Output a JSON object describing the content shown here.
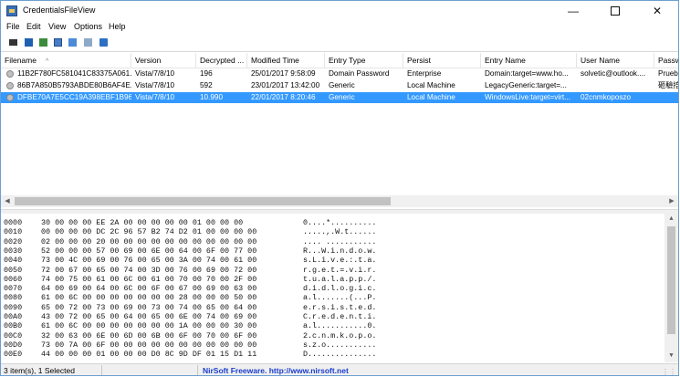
{
  "window": {
    "title": "CredentialsFileView"
  },
  "menu": [
    "File",
    "Edit",
    "View",
    "Options",
    "Help"
  ],
  "toolbar": {
    "buttons": [
      "save-icon",
      "save-all-icon",
      "copy-icon",
      "html-report-icon",
      "properties-icon",
      "options-icon",
      "refresh-icon"
    ]
  },
  "table": {
    "columns": [
      "Filename",
      "Version",
      "Decrypted ...",
      "Modified Time",
      "Entry Type",
      "Persist",
      "Entry Name",
      "User Name",
      "Passw"
    ],
    "sort_indicator": "^",
    "rows": [
      [
        "11B2F780FC581041C83375A061...",
        "Vista/7/8/10",
        "196",
        "25/01/2017 9:58:09",
        "Domain Password",
        "Enterprise",
        "Domain:target=www.ho...",
        "solvetic@outlook....",
        "Prueba"
      ],
      [
        "86B7A850B5793ABDE80B6AF4E...",
        "Vista/7/8/10",
        "592",
        "23/01/2017 13:42:00",
        "Generic",
        "Local Machine",
        "LegacyGeneric:target=...",
        "",
        "砸驗掊"
      ],
      [
        "DFBE70A7E5CC19A398EBF1B96...",
        "Vista/7/8/10",
        "10.990",
        "22/01/2017 8:20:46",
        "Generic",
        "Local Machine",
        "WindowsLive:target=virt...",
        "02cnmkoposzo",
        ""
      ]
    ],
    "selected_row": 2
  },
  "hex": [
    {
      "offset": "0000",
      "bytes": "30 00 00 00 EE 2A 00 00 00 00 00 01 00 00 00",
      "ascii": "0....*.........."
    },
    {
      "offset": "0010",
      "bytes": "00 00 00 00 DC 2C 96 57 B2 74 D2 01 00 00 00 00",
      "ascii": ".....,.W.t......"
    },
    {
      "offset": "0020",
      "bytes": "02 00 00 00 20 00 00 00 00 00 00 00 00 00 00 00",
      "ascii": ".... ..........."
    },
    {
      "offset": "0030",
      "bytes": "52 00 00 00 57 00 69 00 6E 00 64 00 6F 00 77 00",
      "ascii": "R...W.i.n.d.o.w."
    },
    {
      "offset": "0040",
      "bytes": "73 00 4C 00 69 00 76 00 65 00 3A 00 74 00 61 00",
      "ascii": "s.L.i.v.e.:.t.a."
    },
    {
      "offset": "0050",
      "bytes": "72 00 67 00 65 00 74 00 3D 00 76 00 69 00 72 00",
      "ascii": "r.g.e.t.=.v.i.r."
    },
    {
      "offset": "0060",
      "bytes": "74 00 75 00 61 00 6C 00 61 00 70 00 70 00 2F 00",
      "ascii": "t.u.a.l.a.p.p./."
    },
    {
      "offset": "0070",
      "bytes": "64 00 69 00 64 00 6C 00 6F 00 67 00 69 00 63 00",
      "ascii": "d.i.d.l.o.g.i.c."
    },
    {
      "offset": "0080",
      "bytes": "61 00 6C 00 00 00 00 00 00 00 28 00 00 00 50 00",
      "ascii": "a.l.......(...P."
    },
    {
      "offset": "0090",
      "bytes": "65 00 72 00 73 00 69 00 73 00 74 00 65 00 64 00",
      "ascii": "e.r.s.i.s.t.e.d."
    },
    {
      "offset": "00A0",
      "bytes": "43 00 72 00 65 00 64 00 65 00 6E 00 74 00 69 00",
      "ascii": "C.r.e.d.e.n.t.i."
    },
    {
      "offset": "00B0",
      "bytes": "61 00 6C 00 00 00 00 00 00 00 1A 00 00 00 30 00",
      "ascii": "a.l...........0."
    },
    {
      "offset": "00C0",
      "bytes": "32 00 63 00 6E 00 6D 00 6B 00 6F 00 70 00 6F 00",
      "ascii": "2.c.n.m.k.o.p.o."
    },
    {
      "offset": "00D0",
      "bytes": "73 00 7A 00 6F 00 00 00 00 00 00 00 00 00 00 00",
      "ascii": "s.z.o..........."
    },
    {
      "offset": "00E0",
      "bytes": "44 00 00 00 01 00 00 00 D0 8C 9D DF 01 15 D1 11",
      "ascii": "D..............."
    }
  ],
  "status": {
    "items_text": "3 item(s), 1 Selected",
    "link_text": "NirSoft Freeware.  http://www.nirsoft.net"
  },
  "colors": {
    "selection": "#3399ff",
    "link": "#1a3ccc"
  }
}
